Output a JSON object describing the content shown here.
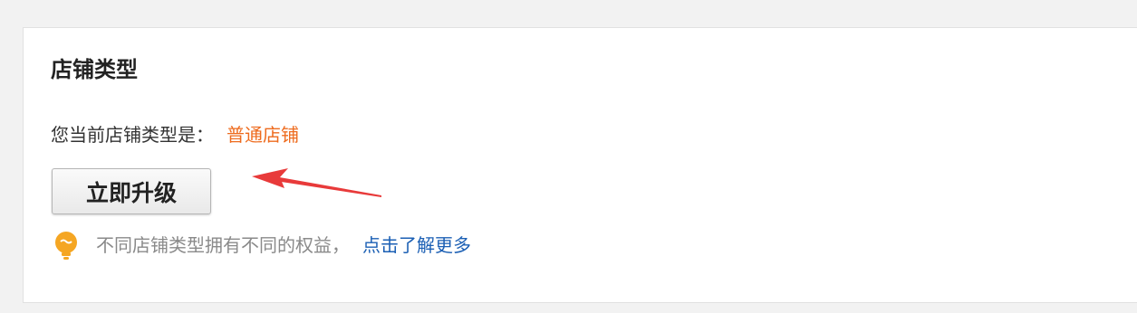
{
  "card": {
    "title": "店铺类型",
    "current_type_label": "您当前店铺类型是：",
    "current_type_value": "普通店铺",
    "upgrade_button_label": "立即升级",
    "tip_text": "不同店铺类型拥有不同的权益，",
    "tip_link_label": "点击了解更多"
  },
  "colors": {
    "accent_orange": "#ee6b1e",
    "link_blue": "#1b5fb4",
    "annotation_red": "#e83a3a",
    "tip_icon_orange": "#f5a623"
  },
  "icons": {
    "annotation_arrow": "arrow-left-icon",
    "tip": "lightbulb-icon"
  }
}
